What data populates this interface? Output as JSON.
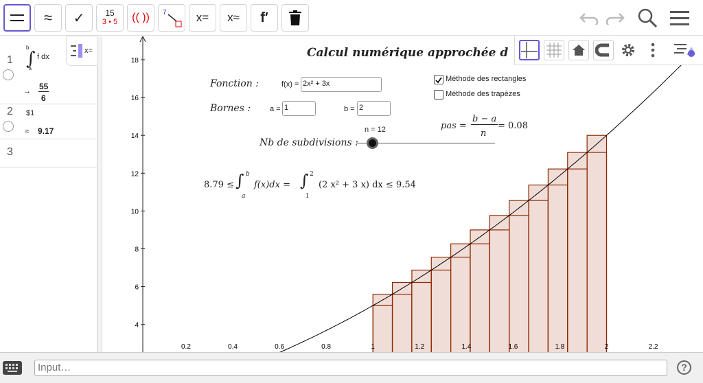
{
  "toolbar": {
    "tool_frac_top": "15",
    "tool_frac_bottom": "3 • 5",
    "tool_paren": "(( ))",
    "tool_seven": "7",
    "tool_solve_exact": "x=",
    "tool_solve_numeric": "x≈",
    "tool_derivative": "f′"
  },
  "algebra": {
    "toggle_label": "x=",
    "row1": {
      "num": "1",
      "integral_upper": "b",
      "integral_lower": "a",
      "integral_body": "f dx",
      "result_num": "55",
      "result_den": "6"
    },
    "row2": {
      "num": "2",
      "input": "$1",
      "approx": "≈",
      "result": "9.17"
    },
    "row3": {
      "num": "3"
    }
  },
  "graphics": {
    "title": "Calcul numérique approchée d",
    "fonction_label": "Fonction  :",
    "fx_prefix": "f(x) =",
    "fx_value": "2x² + 3x",
    "bornes_label": "Bornes  :",
    "a_prefix": "a =",
    "a_value": "1",
    "b_prefix": "b =",
    "b_value": "2",
    "n_label": "n = 12",
    "subdiv_label": "Nb de subdivisions  :",
    "check_rect": "Méthode des rectangles",
    "check_trap": "Méthode des trapèzes",
    "pas_label": "pas =",
    "pas_num": "b − a",
    "pas_den": "n",
    "pas_value": "= 0.08",
    "ineq_left": "8.79 ≤",
    "ineq_mid": "f(x)dx =",
    "ineq_expr": "(2 x² + 3 x) dx ≤ 9.54",
    "int_b": "b",
    "int_a": "a",
    "int_2": "2",
    "int_1": "1",
    "x_ticks": [
      "0.2",
      "0.4",
      "0.6",
      "0.8",
      "1",
      "1.2",
      "1.4",
      "1.6",
      "1.8",
      "2",
      "2.2"
    ],
    "y_ticks": [
      "4",
      "6",
      "8",
      "10",
      "12",
      "14",
      "16",
      "18"
    ],
    "n": 12,
    "a": 1,
    "b": 2,
    "colors": {
      "bar_fill": "#f1ddd7",
      "bar_stroke": "#8b2a00",
      "curve": "#000000"
    }
  },
  "inputbar": {
    "placeholder": "Input…"
  }
}
